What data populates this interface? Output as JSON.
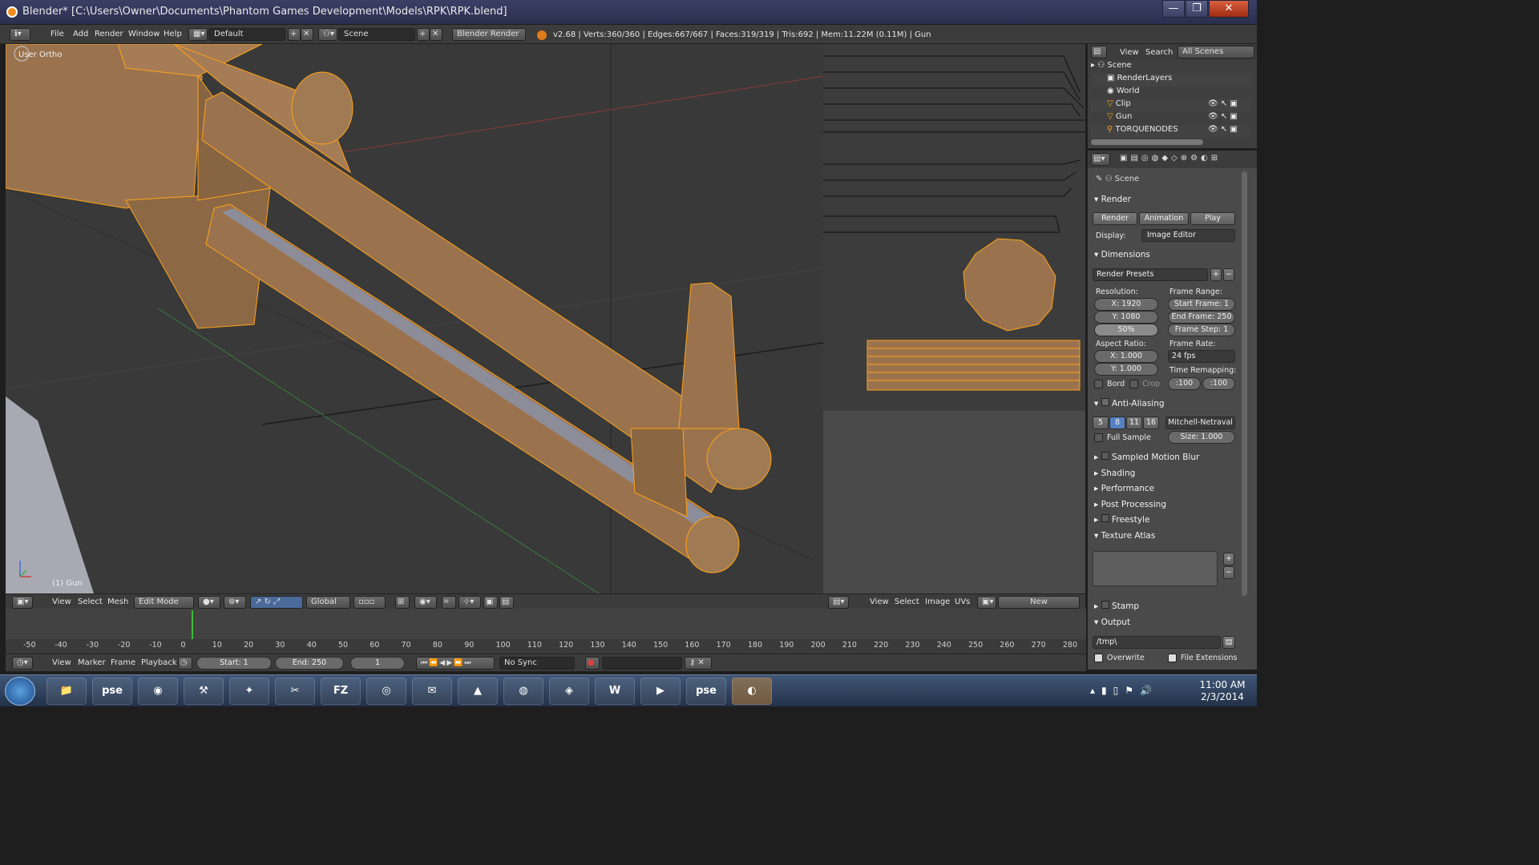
{
  "titlebar": {
    "title": "Blender* [C:\\Users\\Owner\\Documents\\Phantom Games Development\\Models\\RPK\\RPK.blend]",
    "minimize": "—",
    "maximize": "❐",
    "close": "✕"
  },
  "infobar": {
    "menus": [
      "File",
      "Add",
      "Render",
      "Window",
      "Help"
    ],
    "layout": "Default",
    "scene": "Scene",
    "engine": "Blender Render",
    "stats": "v2.68 | Verts:360/360 | Edges:667/667 | Faces:319/319 | Tris:692 | Mem:11.22M (0.11M) | Gun"
  },
  "viewport": {
    "view_label": "User Ortho",
    "object_label": "(1) Gun",
    "header": {
      "menus": [
        "View",
        "Select",
        "Mesh"
      ],
      "mode": "Edit Mode",
      "orientation": "Global"
    }
  },
  "uv_editor": {
    "header": {
      "menus": [
        "View",
        "Select",
        "Image",
        "UVs"
      ],
      "new_label": "New"
    }
  },
  "outliner": {
    "menus": [
      "View",
      "Search"
    ],
    "filter": "All Scenes",
    "items": [
      {
        "label": "Scene",
        "indent": 0
      },
      {
        "label": "RenderLayers",
        "indent": 1
      },
      {
        "label": "World",
        "indent": 1
      },
      {
        "label": "Clip",
        "indent": 1
      },
      {
        "label": "Gun",
        "indent": 1
      },
      {
        "label": "TORQUENODES",
        "indent": 1
      }
    ]
  },
  "properties": {
    "context": "Scene",
    "render": {
      "title": "Render",
      "render_btn": "Render",
      "animation_btn": "Animation",
      "play_btn": "Play",
      "display_label": "Display:",
      "display_value": "Image Editor"
    },
    "dimensions": {
      "title": "Dimensions",
      "presets": "Render Presets",
      "resolution_label": "Resolution:",
      "res_x": "X: 1920",
      "res_y": "Y: 1080",
      "res_pct": "50%",
      "frame_range_label": "Frame Range:",
      "start_frame": "Start Frame: 1",
      "end_frame": "End Frame: 250",
      "frame_step": "Frame Step: 1",
      "aspect_label": "Aspect Ratio:",
      "aspect_x": "X: 1.000",
      "aspect_y": "Y: 1.000",
      "frame_rate_label": "Frame Rate:",
      "frame_rate": "24 fps",
      "remap_label": "Time Remapping:",
      "remap_old": ":100",
      "remap_new": ":100",
      "bord": "Bord",
      "crop": "Crop"
    },
    "antialiasing": {
      "title": "Anti-Aliasing",
      "samples": [
        "5",
        "8",
        "11",
        "16"
      ],
      "filter": "Mitchell-Netraval",
      "full_sample": "Full Sample",
      "size": "Size: 1.000"
    },
    "collapsed_panels": [
      "Sampled Motion Blur",
      "Shading",
      "Performance",
      "Post Processing",
      "Freestyle"
    ],
    "texture_atlas": {
      "title": "Texture Atlas"
    },
    "stamp": "Stamp",
    "output": {
      "title": "Output",
      "path": "/tmp\\",
      "overwrite": "Overwrite",
      "file_extensions": "File Extensions"
    }
  },
  "timeline": {
    "ruler": [
      "-50",
      "-40",
      "-30",
      "-20",
      "-10",
      "0",
      "10",
      "20",
      "30",
      "40",
      "50",
      "60",
      "70",
      "80",
      "90",
      "100",
      "110",
      "120",
      "130",
      "140",
      "150",
      "160",
      "170",
      "180",
      "190",
      "200",
      "210",
      "220",
      "230",
      "240",
      "250",
      "260",
      "270",
      "280"
    ],
    "menus": [
      "View",
      "Marker",
      "Frame",
      "Playback"
    ],
    "start": "Start: 1",
    "end": "End: 250",
    "current": "1",
    "sync": "No Sync"
  },
  "taskbar": {
    "items": [
      "Start",
      "Explorer",
      "pse",
      "Ubi",
      "Hammer",
      "Crystals",
      "Snip",
      "FileZilla",
      "Chrome",
      "Thunderbird",
      "Adobe",
      "Steam",
      "Unity",
      "Word",
      "Player",
      "pse",
      "Blender"
    ],
    "time": "11:00 AM",
    "date": "2/3/2014"
  },
  "colors": {
    "mesh_face": "#9a734e",
    "mesh_edge": "#ffa31a",
    "viewport_bg": "#393939",
    "uv_bg": "#4a4a4a"
  }
}
